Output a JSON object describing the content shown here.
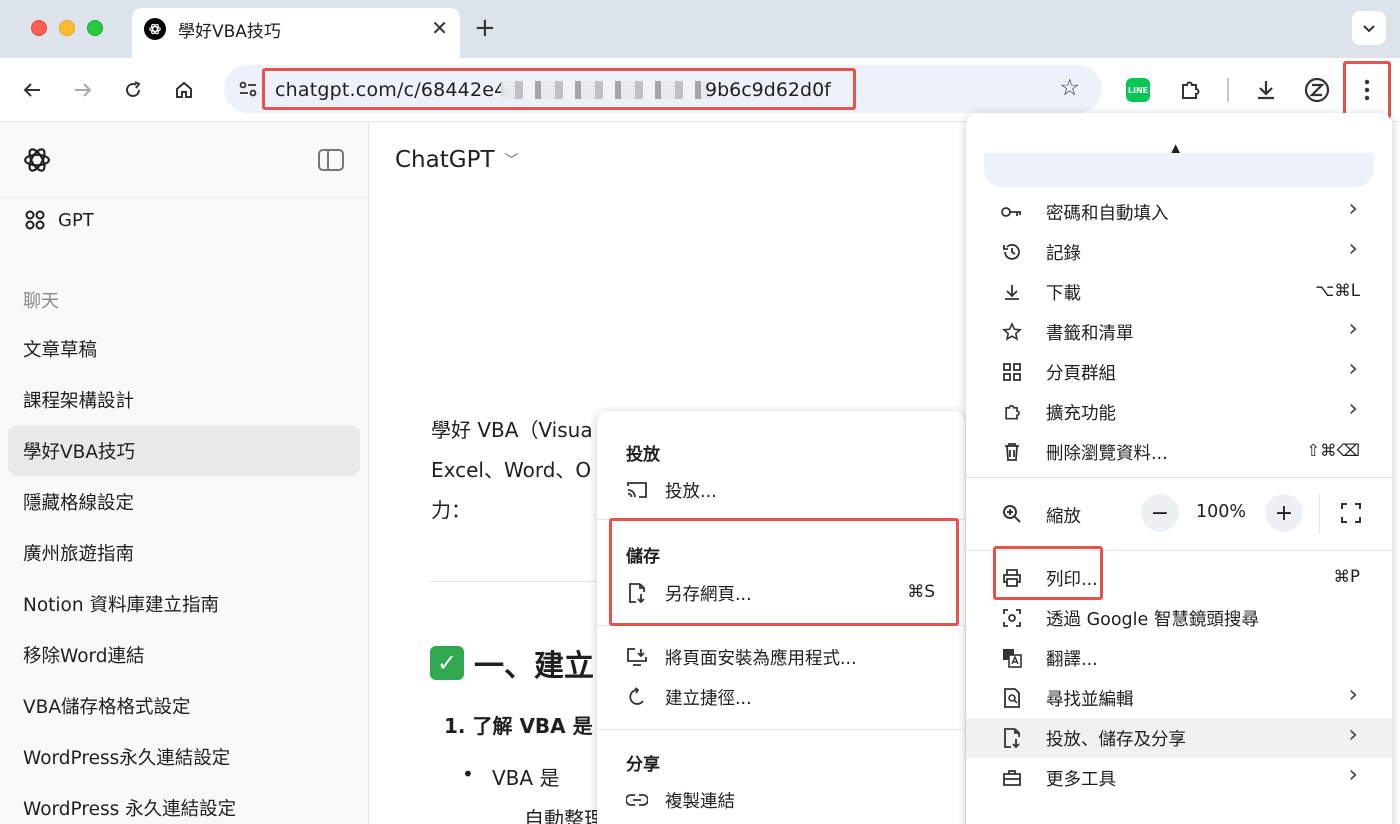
{
  "tab": {
    "title": "學好VBA技巧"
  },
  "omnibox": {
    "url_start": "chatgpt.com/c/68442e4",
    "url_end": "9b6c9d62d0f"
  },
  "sidebar": {
    "gpt_label": "GPT",
    "section": "聊天",
    "items": [
      "文章草稿",
      "課程架構設計",
      "學好VBA技巧",
      "隱藏格線設定",
      "廣州旅遊指南",
      "Notion 資料庫建立指南",
      "移除Word連結",
      "VBA儲存格格式設定",
      "WordPress永久連結設定",
      "WordPress 永久連結設定"
    ],
    "active_index": 2
  },
  "main": {
    "model": "ChatGPT",
    "para_lines": [
      "學好 VBA（Visua",
      "Excel、Word、O",
      "力："
    ],
    "heading": "一、建立",
    "list_item_1": "1.  了解 VBA 是",
    "bullet_1": "VBA 是",
    "bullet_1_cont": "自動整理"
  },
  "submenu": {
    "cast_heading": "投放",
    "cast_item": "投放...",
    "save_heading": "儲存",
    "save_page": "另存網頁...",
    "save_page_shortcut": "⌘S",
    "install_app": "將頁面安裝為應用程式...",
    "create_shortcut": "建立捷徑...",
    "share_heading": "分享",
    "copy_link": "複製連結"
  },
  "menu": {
    "items_top": [
      {
        "label": "密碼和自動填入",
        "icon": "key-icon",
        "arrow": true,
        "shortcut": ""
      },
      {
        "label": "記錄",
        "icon": "history-icon",
        "arrow": true,
        "shortcut": ""
      },
      {
        "label": "下載",
        "icon": "download-icon",
        "arrow": false,
        "shortcut": "⌥⌘L"
      },
      {
        "label": "書籤和清單",
        "icon": "star-icon",
        "arrow": true,
        "shortcut": ""
      },
      {
        "label": "分頁群組",
        "icon": "grid-icon",
        "arrow": true,
        "shortcut": ""
      },
      {
        "label": "擴充功能",
        "icon": "puzzle-icon",
        "arrow": true,
        "shortcut": ""
      },
      {
        "label": "刪除瀏覽資料...",
        "icon": "trash-icon",
        "arrow": false,
        "shortcut": "⇧⌘⌫"
      }
    ],
    "zoom_label": "縮放",
    "zoom_minus": "−",
    "zoom_value": "100%",
    "zoom_plus": "+",
    "items_bottom": [
      {
        "label": "列印...",
        "icon": "print-icon",
        "arrow": false,
        "shortcut": "⌘P"
      },
      {
        "label": "透過 Google 智慧鏡頭搜尋",
        "icon": "lens-icon",
        "arrow": false,
        "shortcut": ""
      },
      {
        "label": "翻譯...",
        "icon": "translate-icon",
        "arrow": false,
        "shortcut": ""
      },
      {
        "label": "尋找並編輯",
        "icon": "find-icon",
        "arrow": true,
        "shortcut": ""
      },
      {
        "label": "投放、儲存及分享",
        "icon": "cast-save-share-icon",
        "arrow": true,
        "shortcut": ""
      },
      {
        "label": "更多工具",
        "icon": "toolbox-icon",
        "arrow": true,
        "shortcut": ""
      }
    ],
    "highlighted_label": "投放、儲存及分享"
  },
  "colors": {
    "highlight_box": "#e4544c",
    "tab_strip": "#dde3ea",
    "omnibox": "#edf2fa"
  }
}
